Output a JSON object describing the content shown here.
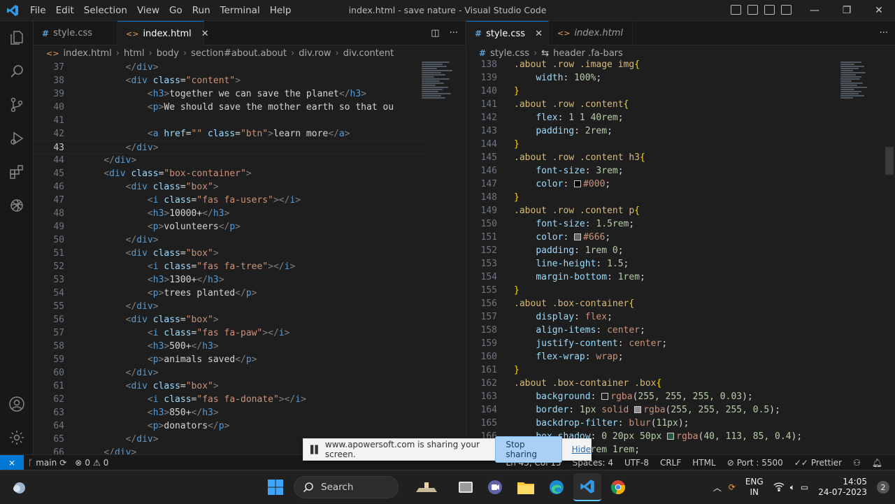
{
  "titlebar": {
    "menu": [
      "File",
      "Edit",
      "Selection",
      "View",
      "Go",
      "Run",
      "Terminal",
      "Help"
    ],
    "title": "index.html - save nature - Visual Studio Code"
  },
  "left_editor": {
    "tabs": [
      {
        "label": "style.css",
        "icon": "css-hash-icon",
        "active": false
      },
      {
        "label": "index.html",
        "icon": "html-angle-icon",
        "active": true
      }
    ],
    "breadcrumbs": [
      "index.html",
      "html",
      "body",
      "section#about.about",
      "div.row",
      "div.content"
    ],
    "current_line": 43
  },
  "right_editor": {
    "tabs": [
      {
        "label": "style.css",
        "icon": "css-hash-icon",
        "active": true
      },
      {
        "label": "index.html",
        "icon": "html-angle-icon",
        "active": false
      }
    ],
    "breadcrumbs": [
      "style.css",
      "header .fa-bars"
    ]
  },
  "statusbar": {
    "branch": "main",
    "problems": "0",
    "warnings": "0",
    "position": "Ln 43, Col 15",
    "spaces": "Spaces: 4",
    "encoding": "UTF-8",
    "eol": "CRLF",
    "language": "HTML",
    "port": "Port : 5500",
    "formatter": "Prettier"
  },
  "share_banner": {
    "message": "www.apowersoft.com is sharing your screen.",
    "stop_label": "Stop sharing",
    "hide_label": "Hide"
  },
  "taskbar": {
    "search_label": "Search",
    "lang_top": "ENG",
    "lang_bottom": "IN",
    "time": "14:05",
    "date": "24-07-2023",
    "notif_count": "2"
  },
  "colors": {
    "accent": "#0078d4",
    "editor_bg": "#1e1e1e",
    "tag": "#569cd6",
    "attr": "#9cdcfe",
    "string": "#ce9178",
    "selector": "#d7ba7d"
  }
}
